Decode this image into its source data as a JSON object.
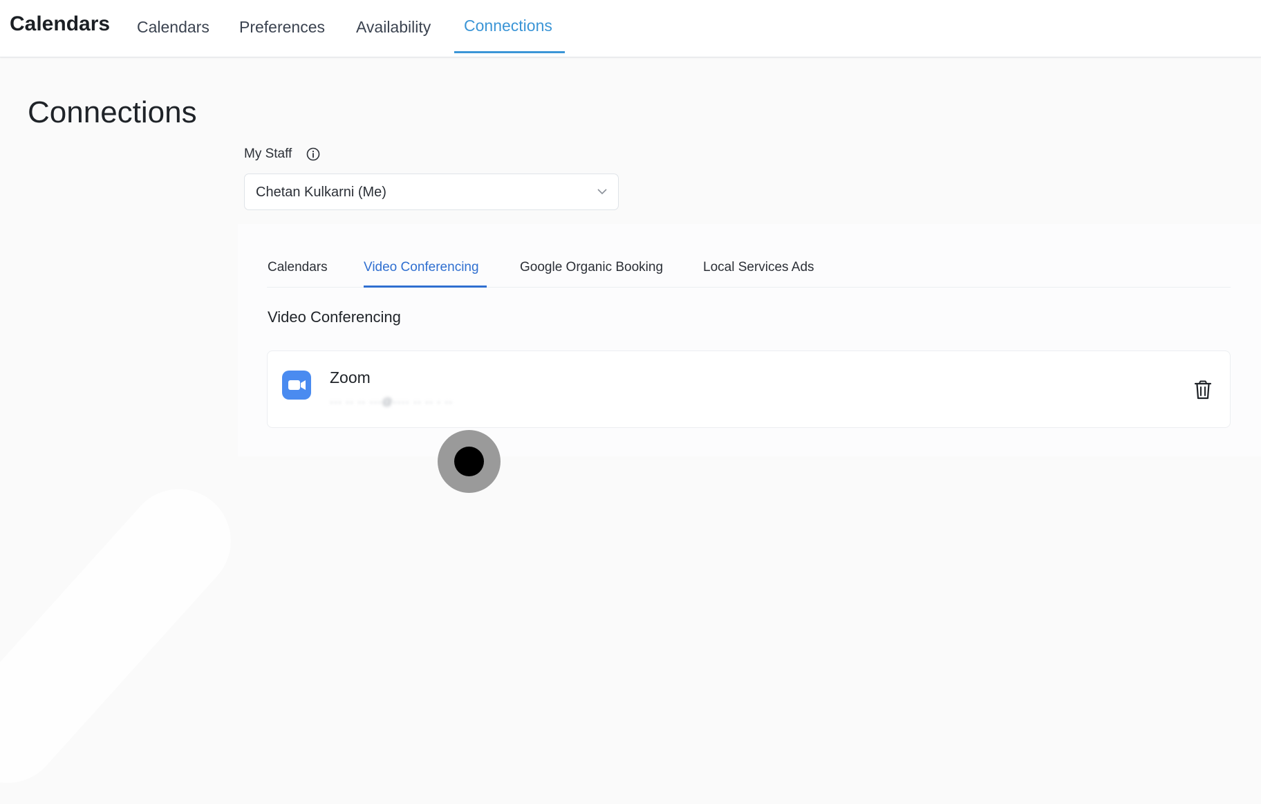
{
  "app": {
    "title": "Calendars"
  },
  "top_nav": {
    "tabs": [
      {
        "label": "Calendars"
      },
      {
        "label": "Preferences"
      },
      {
        "label": "Availability"
      },
      {
        "label": "Connections",
        "active": true
      }
    ]
  },
  "page": {
    "title": "Connections"
  },
  "staff": {
    "label": "My Staff",
    "selected": "Chetan Kulkarni (Me)"
  },
  "sub_tabs": {
    "tabs": [
      {
        "label": "Calendars"
      },
      {
        "label": "Video Conferencing",
        "active": true
      },
      {
        "label": "Google Organic Booking"
      },
      {
        "label": "Local Services Ads"
      }
    ]
  },
  "section": {
    "title": "Video Conferencing"
  },
  "connection": {
    "name": "Zoom",
    "email_blurred": "··· ·· ·· ···@···· ·· ·· · ··"
  },
  "colors": {
    "accent": "#3b95d6",
    "sub_accent": "#2f6fd0",
    "zoom": "#4a8bf0"
  },
  "icons": {
    "info": "info-circle-icon",
    "chevron": "chevron-down-icon",
    "video": "video-camera-icon",
    "trash": "trash-icon"
  }
}
